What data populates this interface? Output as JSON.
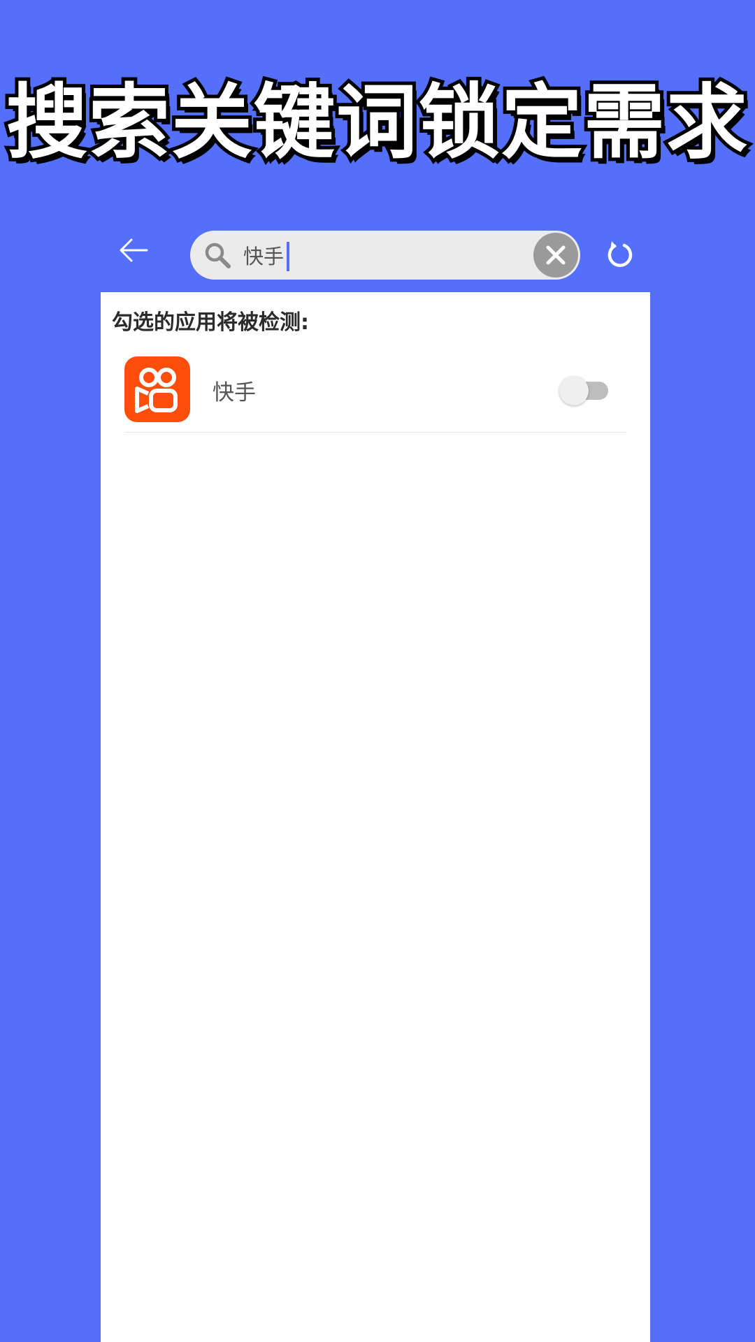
{
  "banner": {
    "headline": "搜索关键词锁定需求"
  },
  "toolbar": {
    "back_icon": "arrow-left-icon",
    "search": {
      "icon": "search-icon",
      "value": "快手",
      "clear_icon": "close-icon"
    },
    "refresh_icon": "refresh-icon"
  },
  "list": {
    "title": "勾选的应用将被检测:",
    "items": [
      {
        "name": "快手",
        "icon": "kuaishou-app-icon",
        "checked": false
      }
    ]
  },
  "colors": {
    "background": "#5470fb",
    "search_bg": "#ebebeb",
    "app_icon_bg": "#ff4e0c",
    "toggle_track": "#bdbdbd"
  }
}
